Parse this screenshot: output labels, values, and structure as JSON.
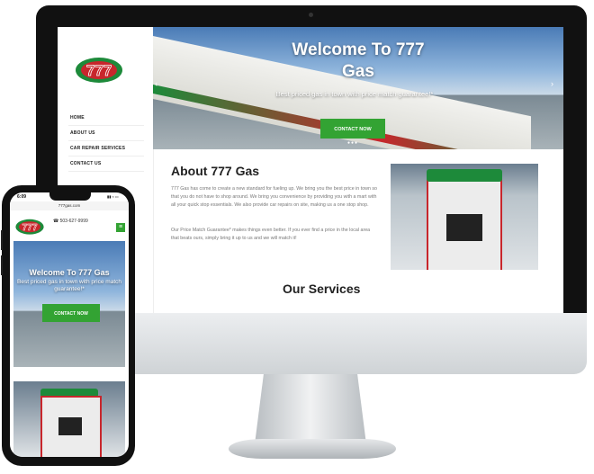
{
  "site": {
    "logo_text": "777",
    "nav": [
      "HOME",
      "ABOUT US",
      "CAR REPAIR SERVICES",
      "CONTACT US"
    ],
    "hero": {
      "title_line1": "Welcome To 777",
      "title_line2": "Gas",
      "subtitle": "Best priced gas in town with price match guarantee!*",
      "cta": "CONTACT NOW",
      "prev": "‹",
      "next": "›",
      "dots": "●●●"
    },
    "about": {
      "title": "About 777 Gas",
      "p1": "777 Gas has come to create a new standard for fueling up. We bring you the best price in town so that you do not have to shop around. We bring you convenience by providing you with a mart with all your quick stop essentials. We also provide car repairs on site, making us a one stop shop.",
      "p2": "Our Price Match Guarantee* makes things even better. If you ever find a price in the local area that beats ours, simply bring it up to us and we will match it!"
    },
    "services_title": "Our Services"
  },
  "mobile": {
    "time": "6:09",
    "status_icons": "▮▮ ≈ ▭",
    "url": "777gas.com",
    "phone": "☎ 503-627-9999",
    "menu": "≡",
    "hero_title": "Welcome To 777 Gas",
    "hero_subtitle": "Best priced gas in town with price match guarantee!*",
    "cta": "CONTACT NOW"
  },
  "brand": {
    "apple": ""
  },
  "colors": {
    "accent_green": "#33a333",
    "brand_red": "#c8262c",
    "brand_green": "#1d8a3a"
  }
}
